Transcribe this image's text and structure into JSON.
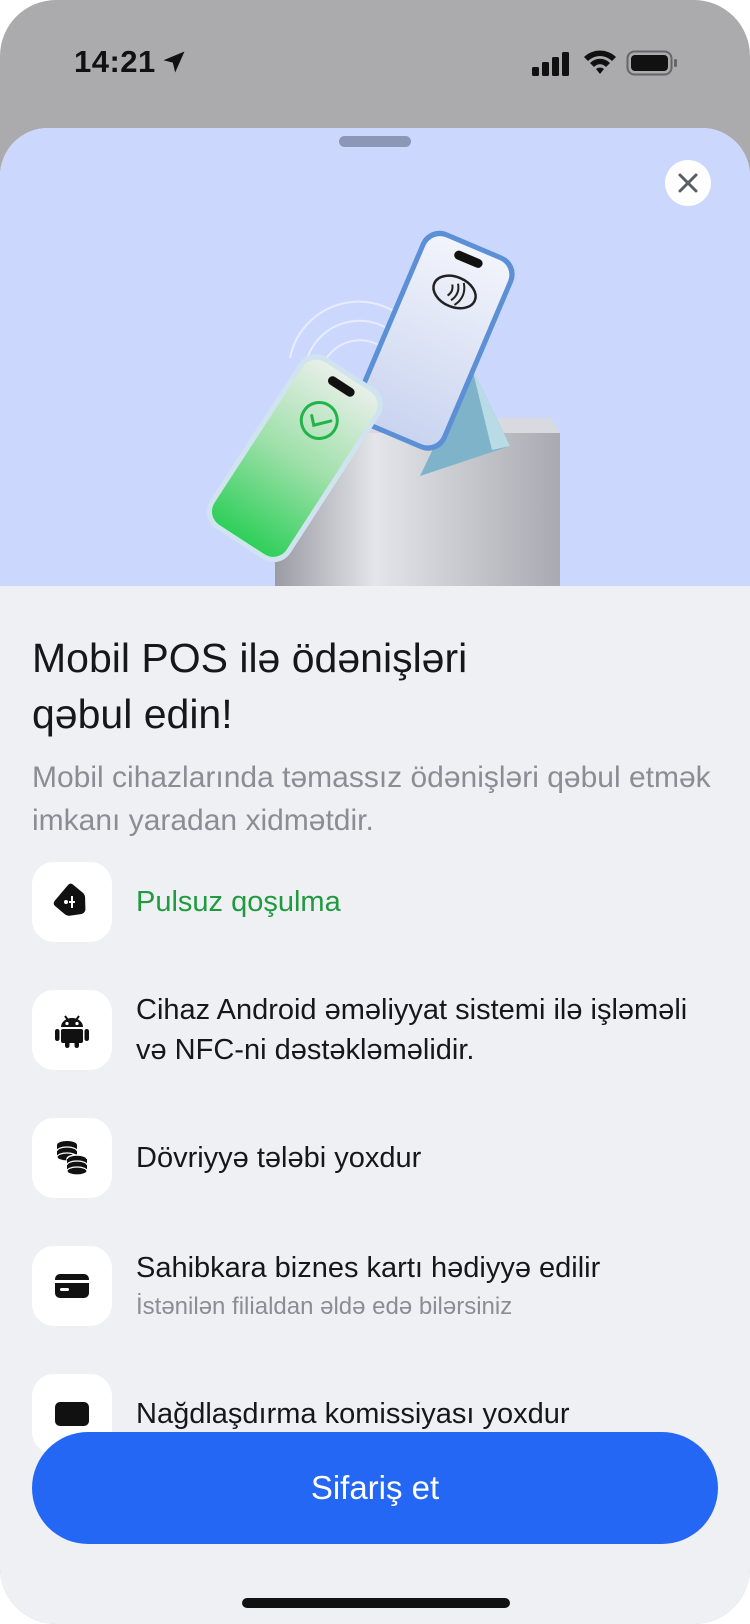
{
  "status_bar": {
    "time": "14:21",
    "icons": [
      "location-arrow-icon",
      "cellular-signal-icon",
      "wifi-icon",
      "battery-icon"
    ]
  },
  "sheet": {
    "close_icon": "close-icon",
    "title": "Mobil POS ilə ödənişləri qəbul edin!",
    "subtitle": "Mobil cihazlarında təmassız ödənişləri qəbul etmək imkanı yaradan xidmətdir.",
    "features": [
      {
        "icon": "tag-icon",
        "label": "Pulsuz qoşulma"
      },
      {
        "icon": "android-icon",
        "label": "Cihaz Android əməliyyat sistemi ilə işləməli və NFC-ni dəstəkləməlidir."
      },
      {
        "icon": "coins-icon",
        "label": "Dövriyyə tələbi yoxdur"
      },
      {
        "icon": "card-icon",
        "label": "Sahibkara biznes kartı hədiyyə edilir",
        "sub": "İstənilən filialdan əldə edə bilərsiniz"
      },
      {
        "icon": "cash-icon",
        "label": "Nağdlaşdırma komissiyası yoxdur"
      }
    ],
    "cta_label": "Sifariş et"
  },
  "colors": {
    "accent": "#2467f5",
    "hero_bg": "#cbd7fd",
    "sheet_bg": "#eff0f4",
    "success_green": "#1f9a3f"
  }
}
